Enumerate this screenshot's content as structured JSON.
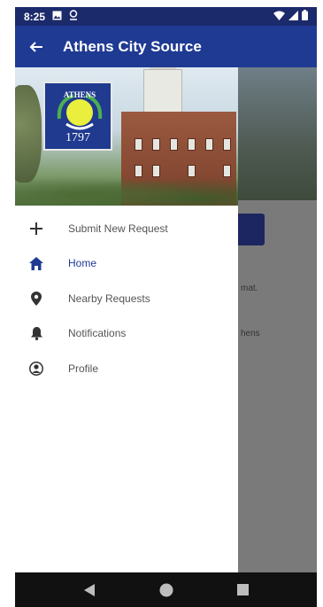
{
  "status_bar": {
    "time": "8:25",
    "left_icons": [
      "image-icon",
      "location-icon"
    ],
    "right_icons": [
      "wifi-icon",
      "signal-icon",
      "battery-icon"
    ]
  },
  "app_bar": {
    "title": "Athens City Source",
    "back_icon": "back-arrow-icon"
  },
  "drawer": {
    "seal": {
      "text": "ATHENS",
      "year": "1797"
    },
    "menu": [
      {
        "label": "Submit New Request",
        "icon": "plus-icon",
        "active": false
      },
      {
        "label": "Home",
        "icon": "home-icon",
        "active": true
      },
      {
        "label": "Nearby Requests",
        "icon": "map-pin-icon",
        "active": false
      },
      {
        "label": "Notifications",
        "icon": "bell-icon",
        "active": false
      },
      {
        "label": "Profile",
        "icon": "profile-icon",
        "active": false
      }
    ]
  },
  "background_screen": {
    "text_fragments": [
      "mat.",
      "hens"
    ]
  },
  "colors": {
    "primary": "#1f3a93",
    "status_bar": "#1b2a6b",
    "nav_bar": "#111111",
    "active_item": "#1f3a93"
  }
}
